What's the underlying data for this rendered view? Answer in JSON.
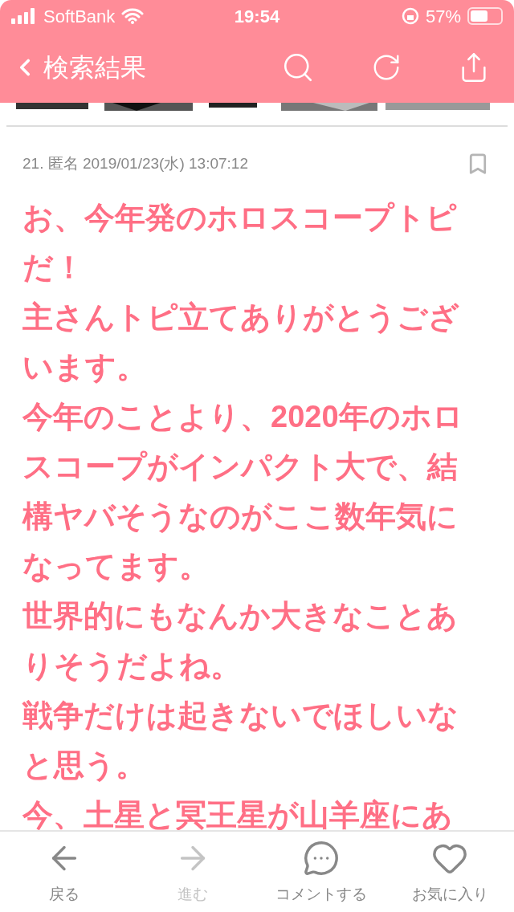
{
  "status_bar": {
    "carrier": "SoftBank",
    "time": "19:54",
    "battery": "57%",
    "battery_icon": {
      "level": 0.57
    }
  },
  "nav_bar": {
    "back_label": "検索結果"
  },
  "post": {
    "number": "21.",
    "author": "匿名",
    "date": "2019/01/23(水) 13:07:12",
    "bookmarked": false,
    "paragraphs": [
      "お、今年発のホロスコープトピだ！",
      "主さんトピ立てありがとうございます。",
      "今年のことより、2020年のホロスコープがインパクト大で、結構ヤバそうなのがここ数年気になってます。",
      "世界的にもなんか大きなことありそうだよね。",
      "戦争だけは起きないでほしいなと思う。",
      "今、土星と冥王星が山羊座にあ"
    ]
  },
  "tab_bar": [
    {
      "kind": "back",
      "label": "戻る",
      "disabled": false
    },
    {
      "kind": "forward",
      "label": "進む",
      "disabled": true
    },
    {
      "kind": "comment",
      "label": "コメントする",
      "disabled": false
    },
    {
      "kind": "favorite",
      "label": "お気に入り",
      "disabled": false
    }
  ]
}
